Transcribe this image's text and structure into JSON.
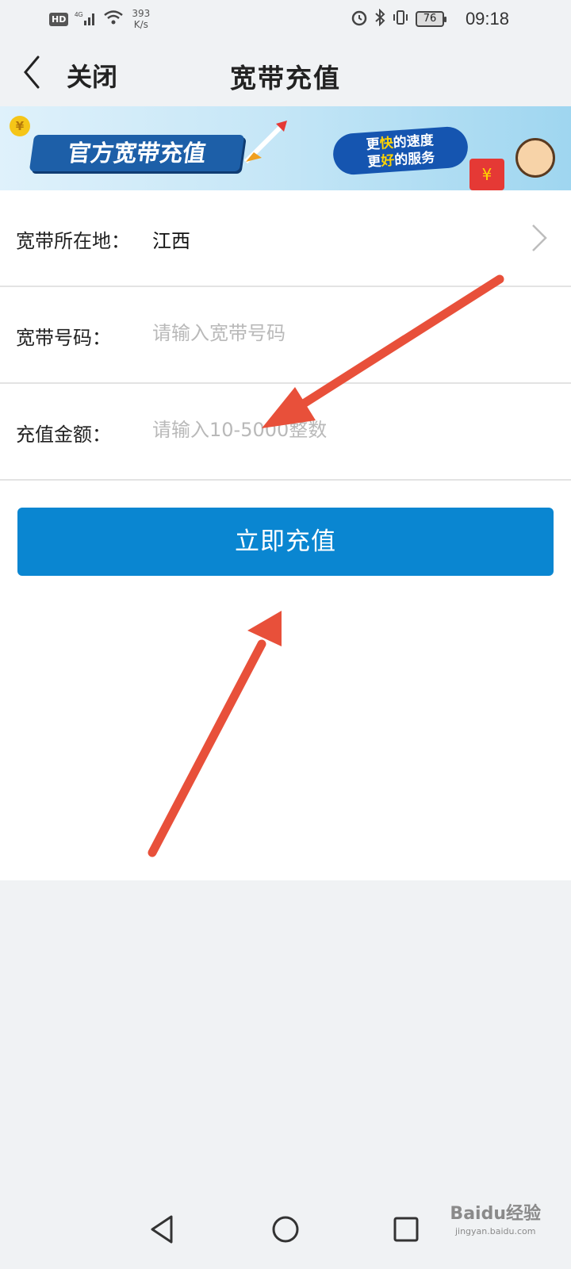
{
  "status_bar": {
    "hd_label": "HD",
    "signal_label": "4G",
    "net_speed_value": "393",
    "net_speed_unit": "K/s",
    "battery_level": "76",
    "time": "09:18"
  },
  "header": {
    "close_label": "关闭",
    "title": "宽带充值"
  },
  "banner": {
    "main_text": "官方宽带充值",
    "sub_line1_a": "更",
    "sub_line1_b": "快",
    "sub_line1_c": "的速度",
    "sub_line2_a": "更",
    "sub_line2_b": "好",
    "sub_line2_c": "的服务",
    "coin_symbol": "¥",
    "redbag_symbol": "¥"
  },
  "form": {
    "location_label": "宽带所在地：",
    "location_value": "江西",
    "number_label": "宽带号码：",
    "number_placeholder": "请输入宽带号码",
    "amount_label": "充值金额：",
    "amount_placeholder": "请输入10-5000整数"
  },
  "submit_label": "立即充值",
  "watermark": {
    "brand": "Baidu经验",
    "url": "jingyan.baidu.com"
  },
  "colors": {
    "primary_button": "#0a86d1",
    "annotation_arrow": "#e8503a",
    "page_background": "#f0f2f4"
  }
}
